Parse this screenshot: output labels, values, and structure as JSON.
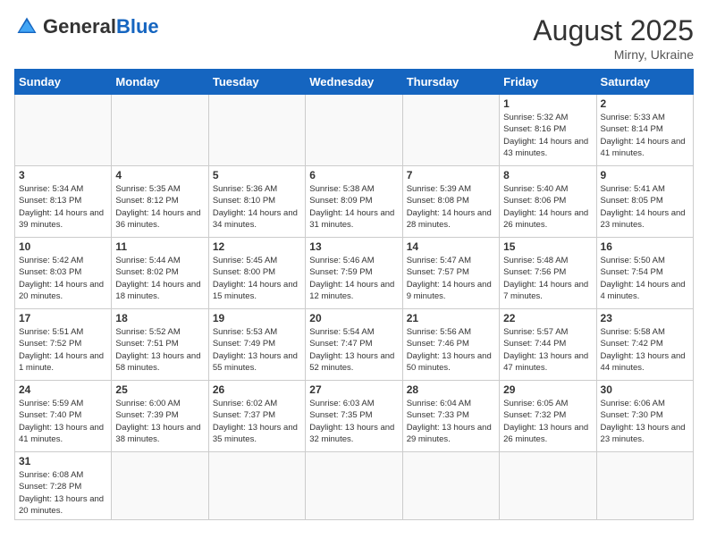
{
  "logo": {
    "general": "General",
    "blue": "Blue"
  },
  "title": {
    "month_year": "August 2025",
    "location": "Mirny, Ukraine"
  },
  "weekdays": [
    "Sunday",
    "Monday",
    "Tuesday",
    "Wednesday",
    "Thursday",
    "Friday",
    "Saturday"
  ],
  "weeks": [
    [
      {
        "day": "",
        "info": ""
      },
      {
        "day": "",
        "info": ""
      },
      {
        "day": "",
        "info": ""
      },
      {
        "day": "",
        "info": ""
      },
      {
        "day": "",
        "info": ""
      },
      {
        "day": "1",
        "info": "Sunrise: 5:32 AM\nSunset: 8:16 PM\nDaylight: 14 hours and 43 minutes."
      },
      {
        "day": "2",
        "info": "Sunrise: 5:33 AM\nSunset: 8:14 PM\nDaylight: 14 hours and 41 minutes."
      }
    ],
    [
      {
        "day": "3",
        "info": "Sunrise: 5:34 AM\nSunset: 8:13 PM\nDaylight: 14 hours and 39 minutes."
      },
      {
        "day": "4",
        "info": "Sunrise: 5:35 AM\nSunset: 8:12 PM\nDaylight: 14 hours and 36 minutes."
      },
      {
        "day": "5",
        "info": "Sunrise: 5:36 AM\nSunset: 8:10 PM\nDaylight: 14 hours and 34 minutes."
      },
      {
        "day": "6",
        "info": "Sunrise: 5:38 AM\nSunset: 8:09 PM\nDaylight: 14 hours and 31 minutes."
      },
      {
        "day": "7",
        "info": "Sunrise: 5:39 AM\nSunset: 8:08 PM\nDaylight: 14 hours and 28 minutes."
      },
      {
        "day": "8",
        "info": "Sunrise: 5:40 AM\nSunset: 8:06 PM\nDaylight: 14 hours and 26 minutes."
      },
      {
        "day": "9",
        "info": "Sunrise: 5:41 AM\nSunset: 8:05 PM\nDaylight: 14 hours and 23 minutes."
      }
    ],
    [
      {
        "day": "10",
        "info": "Sunrise: 5:42 AM\nSunset: 8:03 PM\nDaylight: 14 hours and 20 minutes."
      },
      {
        "day": "11",
        "info": "Sunrise: 5:44 AM\nSunset: 8:02 PM\nDaylight: 14 hours and 18 minutes."
      },
      {
        "day": "12",
        "info": "Sunrise: 5:45 AM\nSunset: 8:00 PM\nDaylight: 14 hours and 15 minutes."
      },
      {
        "day": "13",
        "info": "Sunrise: 5:46 AM\nSunset: 7:59 PM\nDaylight: 14 hours and 12 minutes."
      },
      {
        "day": "14",
        "info": "Sunrise: 5:47 AM\nSunset: 7:57 PM\nDaylight: 14 hours and 9 minutes."
      },
      {
        "day": "15",
        "info": "Sunrise: 5:48 AM\nSunset: 7:56 PM\nDaylight: 14 hours and 7 minutes."
      },
      {
        "day": "16",
        "info": "Sunrise: 5:50 AM\nSunset: 7:54 PM\nDaylight: 14 hours and 4 minutes."
      }
    ],
    [
      {
        "day": "17",
        "info": "Sunrise: 5:51 AM\nSunset: 7:52 PM\nDaylight: 14 hours and 1 minute."
      },
      {
        "day": "18",
        "info": "Sunrise: 5:52 AM\nSunset: 7:51 PM\nDaylight: 13 hours and 58 minutes."
      },
      {
        "day": "19",
        "info": "Sunrise: 5:53 AM\nSunset: 7:49 PM\nDaylight: 13 hours and 55 minutes."
      },
      {
        "day": "20",
        "info": "Sunrise: 5:54 AM\nSunset: 7:47 PM\nDaylight: 13 hours and 52 minutes."
      },
      {
        "day": "21",
        "info": "Sunrise: 5:56 AM\nSunset: 7:46 PM\nDaylight: 13 hours and 50 minutes."
      },
      {
        "day": "22",
        "info": "Sunrise: 5:57 AM\nSunset: 7:44 PM\nDaylight: 13 hours and 47 minutes."
      },
      {
        "day": "23",
        "info": "Sunrise: 5:58 AM\nSunset: 7:42 PM\nDaylight: 13 hours and 44 minutes."
      }
    ],
    [
      {
        "day": "24",
        "info": "Sunrise: 5:59 AM\nSunset: 7:40 PM\nDaylight: 13 hours and 41 minutes."
      },
      {
        "day": "25",
        "info": "Sunrise: 6:00 AM\nSunset: 7:39 PM\nDaylight: 13 hours and 38 minutes."
      },
      {
        "day": "26",
        "info": "Sunrise: 6:02 AM\nSunset: 7:37 PM\nDaylight: 13 hours and 35 minutes."
      },
      {
        "day": "27",
        "info": "Sunrise: 6:03 AM\nSunset: 7:35 PM\nDaylight: 13 hours and 32 minutes."
      },
      {
        "day": "28",
        "info": "Sunrise: 6:04 AM\nSunset: 7:33 PM\nDaylight: 13 hours and 29 minutes."
      },
      {
        "day": "29",
        "info": "Sunrise: 6:05 AM\nSunset: 7:32 PM\nDaylight: 13 hours and 26 minutes."
      },
      {
        "day": "30",
        "info": "Sunrise: 6:06 AM\nSunset: 7:30 PM\nDaylight: 13 hours and 23 minutes."
      }
    ],
    [
      {
        "day": "31",
        "info": "Sunrise: 6:08 AM\nSunset: 7:28 PM\nDaylight: 13 hours and 20 minutes."
      },
      {
        "day": "",
        "info": ""
      },
      {
        "day": "",
        "info": ""
      },
      {
        "day": "",
        "info": ""
      },
      {
        "day": "",
        "info": ""
      },
      {
        "day": "",
        "info": ""
      },
      {
        "day": "",
        "info": ""
      }
    ]
  ]
}
